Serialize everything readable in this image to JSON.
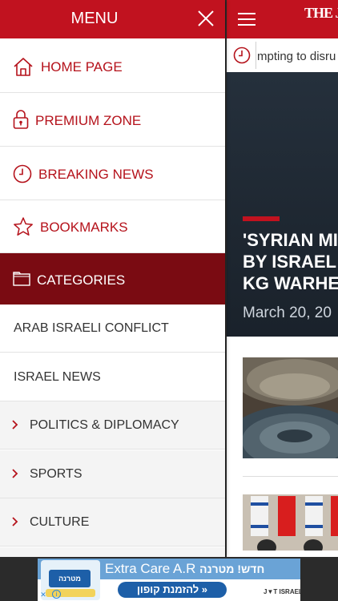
{
  "menu": {
    "title": "MENU",
    "items": [
      {
        "label": "HOME PAGE",
        "icon": "home-icon"
      },
      {
        "label": "PREMIUM ZONE",
        "icon": "lock-icon"
      },
      {
        "label": "BREAKING NEWS",
        "icon": "clock-icon"
      },
      {
        "label": "BOOKMARKS",
        "icon": "star-icon"
      }
    ],
    "categories_header": {
      "label": "CATEGORIES",
      "icon": "folder-icon"
    },
    "categories": [
      {
        "label": "ARAB ISRAELI CONFLICT",
        "expandable": false
      },
      {
        "label": "ISRAEL NEWS",
        "expandable": false
      },
      {
        "label": "POLITICS & DIPLOMACY",
        "expandable": true
      },
      {
        "label": "SPORTS",
        "expandable": true
      },
      {
        "label": "CULTURE",
        "expandable": true
      }
    ]
  },
  "app": {
    "logo": "THE J",
    "ticker": {
      "text": "mpting to disru"
    },
    "hero": {
      "title": "'SYRIAN MIS\nBY ISRAEL C\nKG WARHEA",
      "date": "March 20, 20"
    }
  },
  "ad": {
    "title_text": "Extra Care A.R",
    "brand_text": "חדש! מטרנה",
    "cta": "להזמנת קופון »",
    "product_label": "מטרנה",
    "sponsor": "J▼T ISRAEL",
    "close_icon": "close-icon",
    "info_icon": "info-icon"
  },
  "colors": {
    "brand_red": "#c1121f",
    "categories_bg": "#7a0b12",
    "menu_text": "#b5121b"
  }
}
